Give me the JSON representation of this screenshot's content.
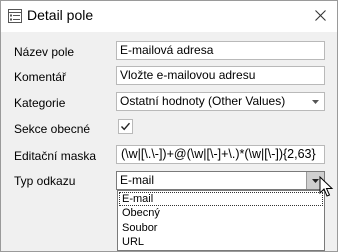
{
  "window": {
    "title": "Detail pole"
  },
  "fields": {
    "nazev_label": "Název pole",
    "nazev_value": "E-mailová adresa",
    "komentar_label": "Komentář",
    "komentar_value": "Vložte e-mailovou adresu",
    "kategorie_label": "Kategorie",
    "kategorie_value": "Ostatní hodnoty (Other Values)",
    "sekce_label": "Sekce obecné",
    "sekce_checked": true,
    "maska_label": "Editační maska",
    "maska_value": "(\\w|[\\.\\-])+@(\\w|[\\-]+\\.)*(\\w|[\\-]){2,63}",
    "typ_label": "Typ odkazu",
    "typ_value": "E-mail"
  },
  "dropdown": {
    "options": [
      "E-mail",
      "Obecný",
      "Soubor",
      "URL"
    ],
    "selected_index": 0
  },
  "icons": {
    "title": "form-icon",
    "close": "close-icon",
    "combo_arrow": "chevron-down-icon",
    "check": "checkmark-icon",
    "cursor": "mouse-pointer-icon"
  }
}
